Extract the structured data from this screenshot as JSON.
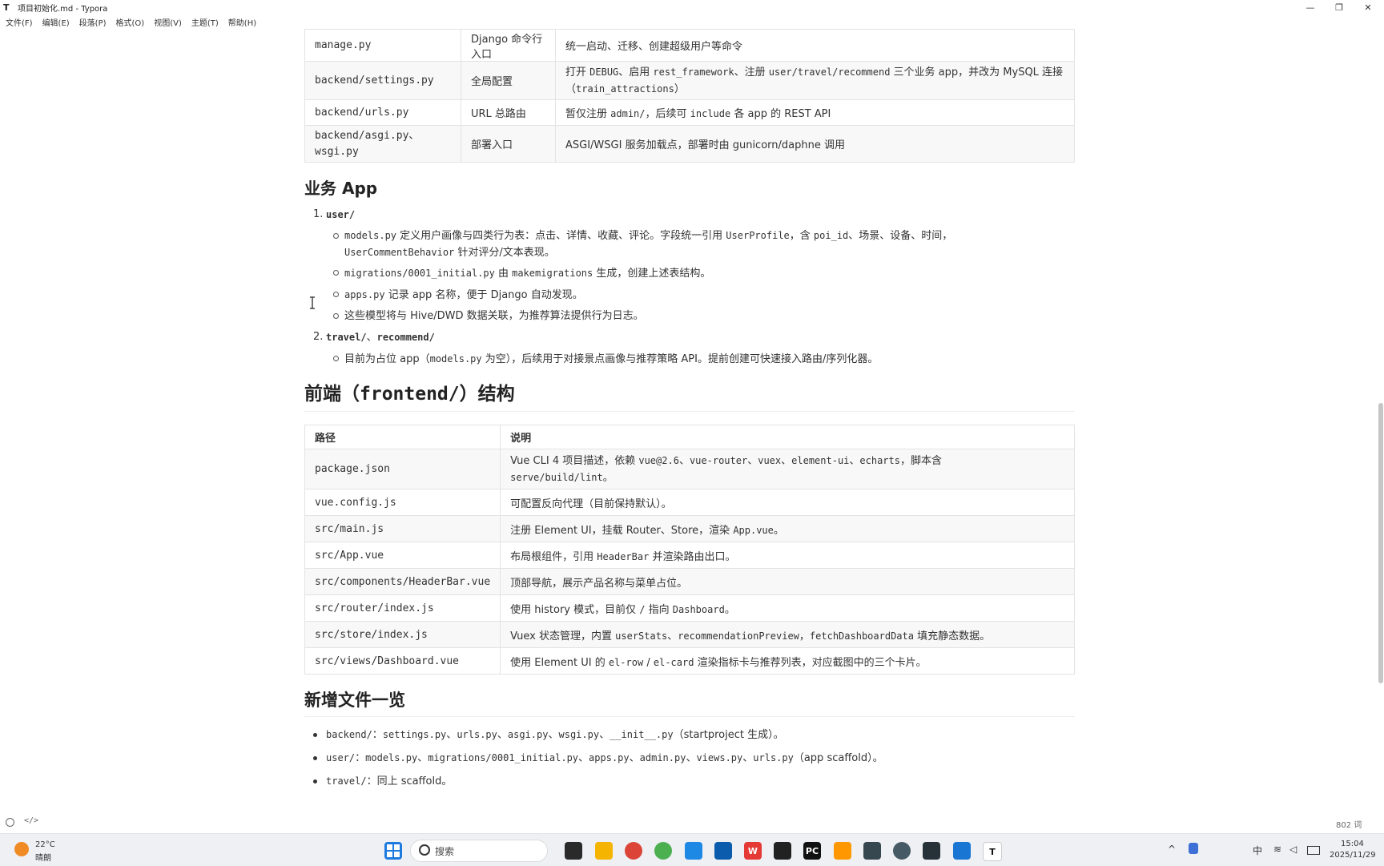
{
  "window": {
    "app_icon": "T",
    "title": "项目初始化.md - Typora",
    "minimize": "—",
    "maximize": "❐",
    "close": "✕"
  },
  "menu": [
    "文件(F)",
    "编辑(E)",
    "段落(P)",
    "格式(O)",
    "视图(V)",
    "主题(T)",
    "帮助(H)"
  ],
  "backend_table": {
    "rows": [
      {
        "path": "manage.py",
        "kind": "Django 命令行入口",
        "desc": "统一启动、迁移、创建超级用户等命令"
      },
      {
        "path": "backend/settings.py",
        "kind": "全局配置",
        "desc_parts": [
          "打开 ",
          "DEBUG",
          "、启用 ",
          "rest_framework",
          "、注册 ",
          "user/travel/recommend",
          " 三个业务 app，并改为 MySQL 连接（",
          "train_attractions",
          "）"
        ]
      },
      {
        "path": "backend/urls.py",
        "kind": "URL 总路由",
        "desc_parts": [
          "暂仅注册 ",
          "admin/",
          "，后续可 ",
          "include",
          " 各 app 的 REST API"
        ]
      },
      {
        "path": "backend/asgi.py、wsgi.py",
        "kind": "部署入口",
        "desc": "ASGI/WSGI 服务加载点，部署时由 gunicorn/daphne 调用"
      }
    ]
  },
  "section_apps": {
    "title": "业务 App",
    "item1": {
      "num": "1.",
      "label": "user/",
      "sub": {
        "s1": [
          "models.py",
          " 定义用户画像与四类行为表：点击、详情、收藏、评论。字段统一引用 ",
          "UserProfile",
          "，含 ",
          "poi_id",
          "、场景、设备、时间，",
          "UserCommentBehavior",
          " 针对评分/文本表现。"
        ],
        "s2": [
          "migrations/0001_initial.py",
          " 由 ",
          "makemigrations",
          " 生成，创建上述表结构。"
        ],
        "s3": [
          "apps.py",
          " 记录 app 名称，便于 Django 自动发现。"
        ],
        "s4": "这些模型将与 Hive/DWD 数据关联，为推荐算法提供行为日志。"
      }
    },
    "item2": {
      "num": "2.",
      "label_a": "travel/",
      "sep": "、",
      "label_b": "recommend/",
      "sub": [
        "目前为占位 app（",
        "models.py",
        " 为空），后续用于对接景点画像与推荐策略 API。提前创建可快速接入路由/序列化器。"
      ]
    }
  },
  "section_frontend": {
    "title_a": "前端（",
    "title_code": "frontend/",
    "title_b": "）结构",
    "headers": [
      "路径",
      "说明"
    ],
    "rows": [
      {
        "path": "package.json",
        "desc_parts": [
          "Vue CLI 4 项目描述，依赖 ",
          "vue@2.6",
          "、",
          "vue-router",
          "、",
          "vuex",
          "、",
          "element-ui",
          "、",
          "echarts",
          "，脚本含 ",
          "serve/build/lint",
          "。"
        ]
      },
      {
        "path": "vue.config.js",
        "desc_parts": [
          "可配置反向代理（目前保持默认）。"
        ]
      },
      {
        "path": "src/main.js",
        "desc_parts": [
          "注册 Element UI，挂载 Router、Store，渲染 ",
          "App.vue",
          "。"
        ]
      },
      {
        "path": "src/App.vue",
        "desc_parts": [
          "布局根组件，引用 ",
          "HeaderBar",
          " 并渲染路由出口。"
        ]
      },
      {
        "path": "src/components/HeaderBar.vue",
        "desc_parts": [
          "顶部导航，展示产品名称与菜单占位。"
        ]
      },
      {
        "path": "src/router/index.js",
        "desc_parts": [
          "使用 history 模式，目前仅 ",
          "/",
          " 指向 ",
          "Dashboard",
          "。"
        ]
      },
      {
        "path": "src/store/index.js",
        "desc_parts": [
          "Vuex 状态管理，内置 ",
          "userStats",
          "、",
          "recommendationPreview",
          "，",
          "fetchDashboardData",
          " 填充静态数据。"
        ]
      },
      {
        "path": "src/views/Dashboard.vue",
        "desc_parts": [
          "使用 Element UI 的 ",
          "el-row",
          " / ",
          "el-card",
          " 渲染指标卡与推荐列表，对应截图中的三个卡片。"
        ]
      }
    ]
  },
  "section_new": {
    "title": "新增文件一览",
    "items": [
      [
        "backend/",
        "：",
        "settings.py",
        "、",
        "urls.py",
        "、",
        "asgi.py",
        "、",
        "wsgi.py",
        "、",
        "__init__.py",
        "（startproject 生成）。"
      ],
      [
        "user/",
        "：",
        "models.py",
        "、",
        "migrations/0001_initial.py",
        "、",
        "apps.py",
        "、",
        "admin.py",
        "、",
        "views.py",
        "、",
        "urls.py",
        "（app scaffold）。"
      ],
      [
        "travel/",
        "：同上 scaffold。"
      ]
    ]
  },
  "status": {
    "word_count": "802 词",
    "toggle": "</>"
  },
  "taskbar": {
    "weather_temp": "22°C",
    "weather_desc": "晴朗",
    "search_placeholder": "搜索",
    "ime": "中",
    "time": "15:04",
    "date": "2025/11/29"
  },
  "colors": {
    "accent": "#2b6cde",
    "border": "#e3e3e3",
    "table_alt": "#f8f8f8"
  }
}
